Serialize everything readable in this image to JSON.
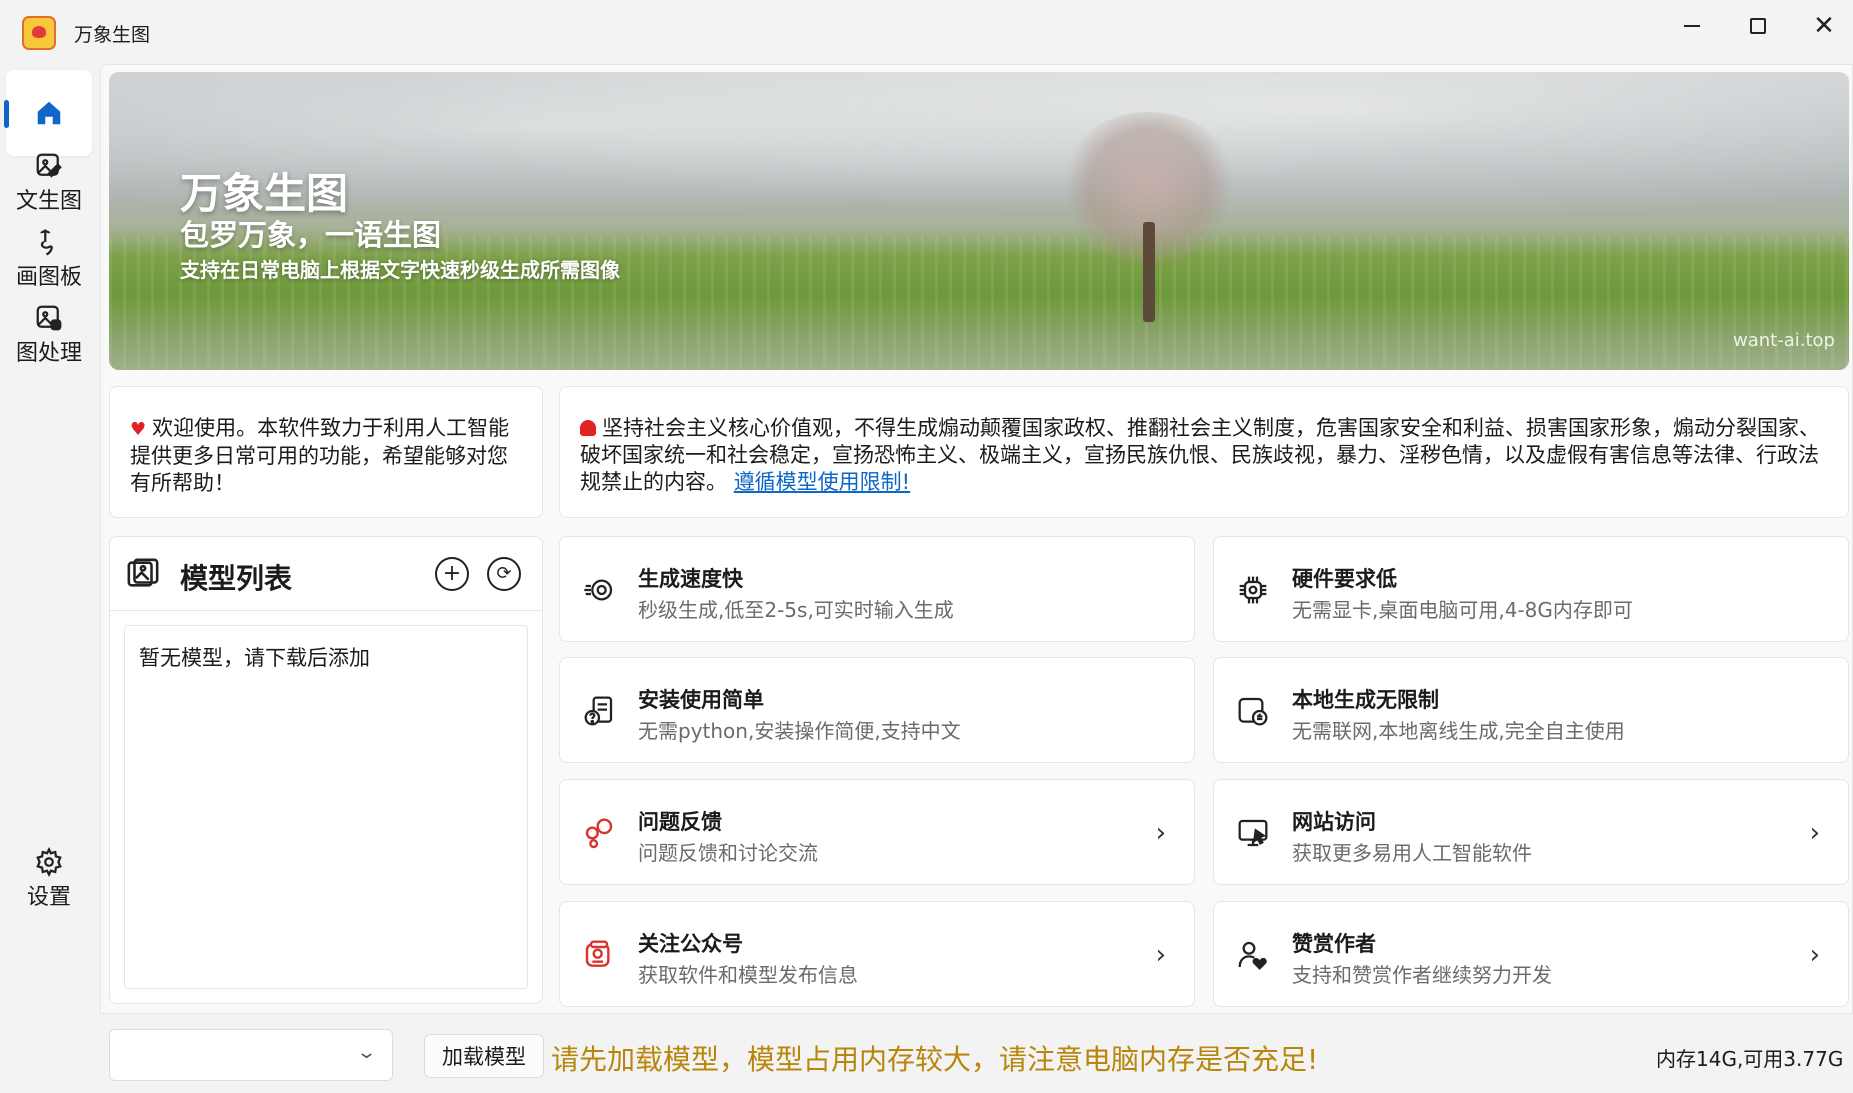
{
  "window": {
    "title": "万象生图",
    "controls": {
      "minimize": "minimize",
      "maximize": "maximize",
      "close": "✕"
    }
  },
  "nav": {
    "items": [
      {
        "label": "",
        "icon": "home-icon",
        "active": true
      },
      {
        "label": "文生图",
        "icon": "image-edit-icon"
      },
      {
        "label": "画图板",
        "icon": "draw-board-icon"
      },
      {
        "label": "图处理",
        "icon": "image-process-icon"
      }
    ],
    "settings_label": "设置"
  },
  "banner": {
    "title": "万象生图",
    "subtitle": "包罗万象，一语生图",
    "description": "支持在日常电脑上根据文字快速秒级生成所需图像",
    "watermark": "want-ai.top"
  },
  "welcome": {
    "text": "欢迎使用。本软件致力于利用人工智能提供更多日常可用的功能，希望能够对您有所帮助！"
  },
  "notice": {
    "text": "坚持社会主义核心价值观，不得生成煽动颠覆国家政权、推翻社会主义制度，危害国家安全和利益、损害国家形象，煽动分裂国家、破坏国家统一和社会稳定，宣扬恐怖主义、极端主义，宣扬民族仇恨、民族歧视，暴力、淫秽色情，以及虚假有害信息等法律、行政法规禁止的内容。",
    "link": "遵循模型使用限制!"
  },
  "model_panel": {
    "title": "模型列表",
    "add": "+",
    "refresh": "⟳",
    "empty_text": "暂无模型，请下载后添加"
  },
  "features": [
    {
      "title": "生成速度快",
      "desc": "秒级生成,低至2-5s,可实时输入生成",
      "icon": "speed-icon",
      "link": false
    },
    {
      "title": "硬件要求低",
      "desc": "无需显卡,桌面电脑可用,4-8G内存即可",
      "icon": "chip-icon",
      "link": false
    },
    {
      "title": "安装使用简单",
      "desc": "无需python,安装操作简便,支持中文",
      "icon": "help-document-icon",
      "link": false
    },
    {
      "title": "本地生成无限制",
      "desc": "无需联网,本地离线生成,完全自主使用",
      "icon": "local-device-icon",
      "link": false
    },
    {
      "title": "问题反馈",
      "desc": "问题反馈和讨论交流",
      "icon": "chat-icon",
      "link": true
    },
    {
      "title": "网站访问",
      "desc": "获取更多易用人工智能软件",
      "icon": "monitor-icon",
      "link": true
    },
    {
      "title": "关注公众号",
      "desc": "获取软件和模型发布信息",
      "icon": "wechat-icon",
      "link": true
    },
    {
      "title": "赞赏作者",
      "desc": "支持和赞赏作者继续努力开发",
      "icon": "support-author-icon",
      "link": true
    }
  ],
  "footer": {
    "model_select_value": "",
    "load_button": "加载模型",
    "warning": "请先加载模型，模型占用内存较大，请注意电脑内存是否充足!",
    "memory": "内存14G,可用3.77G"
  },
  "colors": {
    "accent": "#0e66c6",
    "warning": "#b8860b",
    "danger": "#e02424",
    "icon_red": "#d9342b"
  }
}
